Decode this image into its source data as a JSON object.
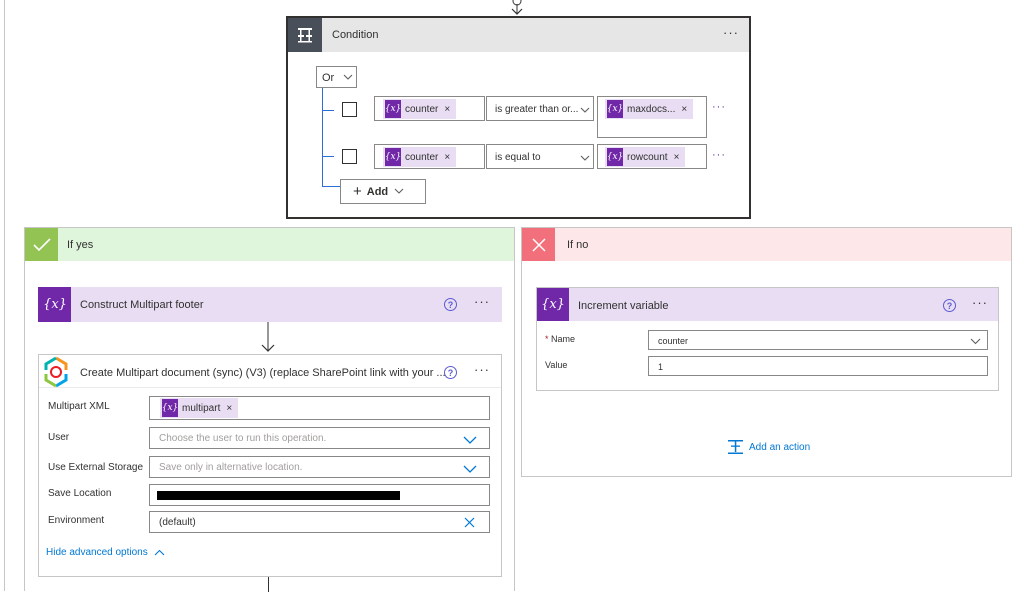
{
  "condition": {
    "title": "Condition",
    "group_operator": "Or",
    "rows": [
      {
        "left_token": "counter",
        "operator": "is greater than or...",
        "right_token": "maxdocs..."
      },
      {
        "left_token": "counter",
        "operator": "is equal to",
        "right_token": "rowcount"
      }
    ],
    "add_label": "Add"
  },
  "if_yes": {
    "title": "If yes",
    "construct_card": {
      "title": "Construct Multipart footer"
    },
    "create_card": {
      "title": "Create Multipart document (sync) (V3) (replace SharePoint link with your ...",
      "fields": [
        {
          "label": "Multipart XML",
          "token": "multipart"
        },
        {
          "label": "User",
          "placeholder": "Choose the user to run this operation."
        },
        {
          "label": "Use External Storage",
          "placeholder": "Save only in alternative location."
        },
        {
          "label": "Save Location",
          "value": ""
        },
        {
          "label": "Environment",
          "value": "(default)"
        }
      ],
      "hide_advanced": "Hide advanced options"
    }
  },
  "if_no": {
    "title": "If no",
    "increment_card": {
      "title": "Increment variable",
      "name_label": "Name",
      "name_value": "counter",
      "value_label": "Value",
      "value_value": "1"
    },
    "add_action": "Add an action"
  },
  "colors": {
    "condition_header": "#e6e6e6",
    "condition_icon_bg": "#484f58",
    "variable_purple": "#7028a8",
    "variable_header": "#e8ddf3",
    "yes_header": "#dff6dd",
    "yes_icon": "#92c353",
    "no_header": "#fde7e9",
    "no_icon": "#f1707b",
    "link_blue": "#0078d4"
  }
}
